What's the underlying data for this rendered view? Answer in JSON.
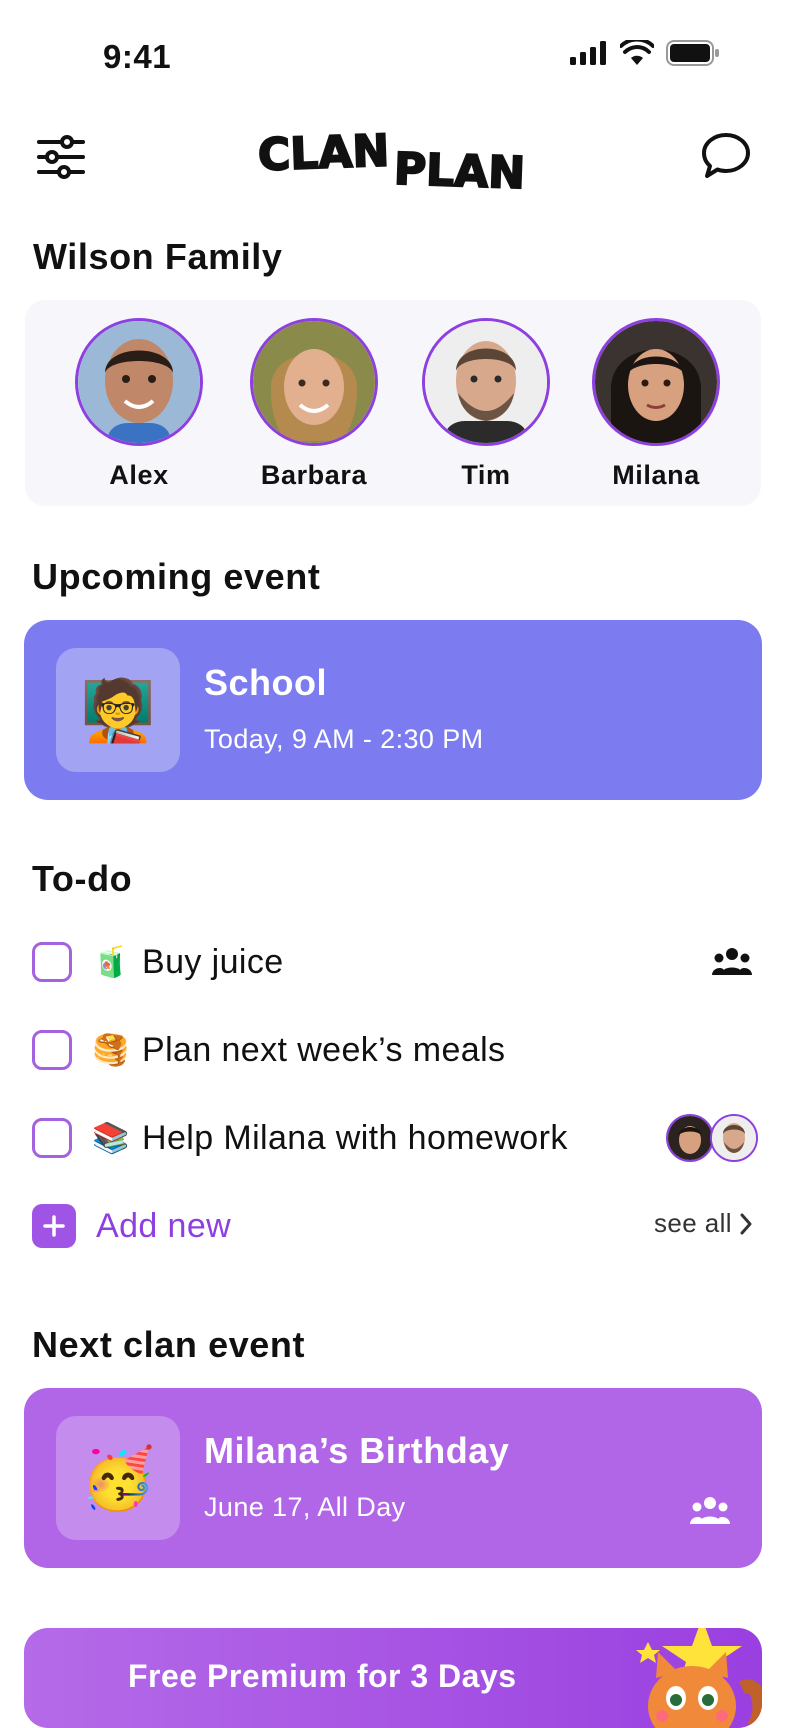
{
  "status_bar": {
    "time": "9:41"
  },
  "header": {
    "logo_text_1": "CLAN",
    "logo_text_2": "PLAN"
  },
  "family": {
    "title": "Wilson Family",
    "members": [
      {
        "name": "Alex"
      },
      {
        "name": "Barbara"
      },
      {
        "name": "Tim"
      },
      {
        "name": "Milana"
      }
    ]
  },
  "upcoming": {
    "title": "Upcoming event",
    "event": {
      "emoji": "🧑‍🏫",
      "title": "School",
      "time": "Today, 9 AM - 2:30 PM"
    }
  },
  "todo": {
    "title": "To-do",
    "items": [
      {
        "emoji": "🧃",
        "label": "Buy juice",
        "assignee": "family-icon"
      },
      {
        "emoji": "🥞",
        "label": "Plan next week’s meals"
      },
      {
        "emoji": "📚",
        "label": "Help Milana with homework",
        "assignee": "avatars"
      }
    ],
    "add_label": "Add new",
    "see_all_label": "see all"
  },
  "clan_event": {
    "title": "Next clan event",
    "event": {
      "emoji": "🥳",
      "title": "Milana’s Birthday",
      "time": "June 17, All Day"
    }
  },
  "premium": {
    "label": "Free Premium for 3 Days"
  },
  "colors": {
    "accent": "#8e3fe0",
    "event_card": "#7c7cf0",
    "clan_card": "#b066e6"
  }
}
